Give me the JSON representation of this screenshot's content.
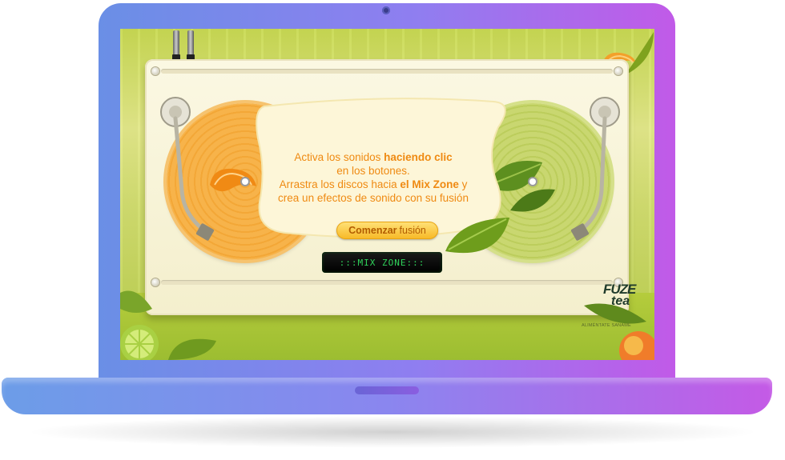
{
  "bubble": {
    "line1_prefix": "Activa los sonidos ",
    "line1_bold": "haciendo clic",
    "line2": "en los botones.",
    "line3_prefix": "Arrastra los discos hacia ",
    "line3_bold": "el Mix Zone",
    "line3_suffix": " y",
    "line4": "crea un efectos de sonido con su fusión"
  },
  "cta": {
    "bold": "Comenzar",
    "rest": "fusión"
  },
  "display": {
    "mix_zone": ":::MIX ZONE:::"
  },
  "brand": {
    "logo_top": "FUZE",
    "logo_bottom": "tea",
    "tagline": "ALIMÉNTATE SANAME"
  },
  "colors": {
    "accent": "#ef8a12",
    "button": "#f7b824",
    "display_text": "#2fd35a"
  }
}
